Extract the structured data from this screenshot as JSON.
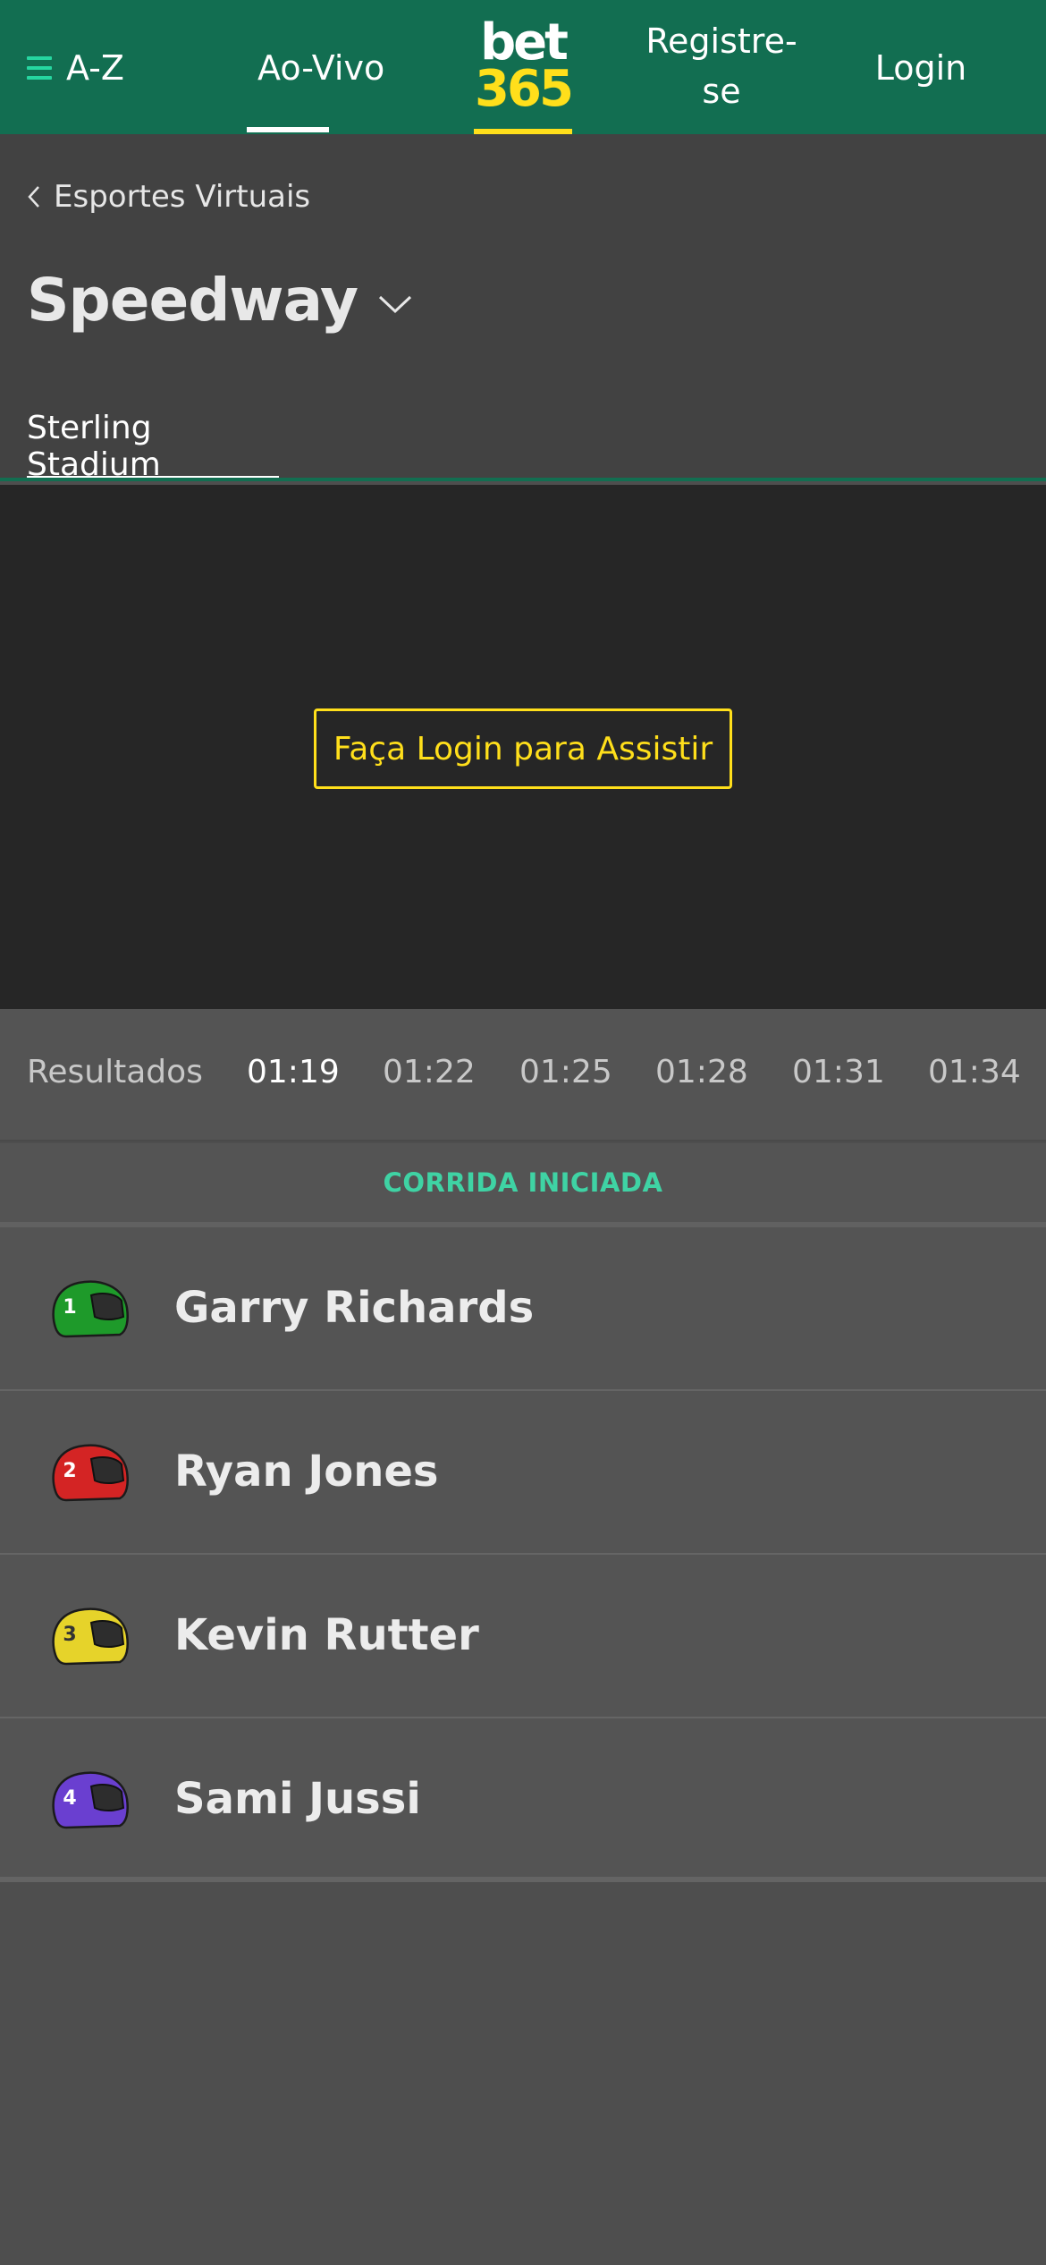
{
  "nav": {
    "az_label": "A-Z",
    "live_label": "Ao-Vivo",
    "logo_top": "bet",
    "logo_bottom": "365",
    "register_label_line1": "Registre-",
    "register_label_line2": "se",
    "login_label": "Login"
  },
  "header": {
    "breadcrumb": "Esportes Virtuais",
    "title": "Speedway",
    "venue_tab": "Sterling Stadium"
  },
  "video": {
    "watch_label": "Faça Login para Assistir"
  },
  "times": {
    "items": [
      "Resultados",
      "01:19",
      "01:22",
      "01:25",
      "01:28",
      "01:31",
      "01:34"
    ],
    "active": "01:19"
  },
  "race": {
    "status": "CORRIDA INICIADA",
    "riders": [
      {
        "number": "1",
        "name": "Garry Richards",
        "helmet_color": "#1e9a2a"
      },
      {
        "number": "2",
        "name": "Ryan Jones",
        "helmet_color": "#d42424"
      },
      {
        "number": "3",
        "name": "Kevin Rutter",
        "helmet_color": "#e6d32a"
      },
      {
        "number": "4",
        "name": "Sami Jussi",
        "helmet_color": "#6a3fd0"
      }
    ]
  },
  "colors": {
    "brand_green": "#126e51",
    "accent_yellow": "#ffdf1b",
    "status_green": "#3fd3a4"
  }
}
